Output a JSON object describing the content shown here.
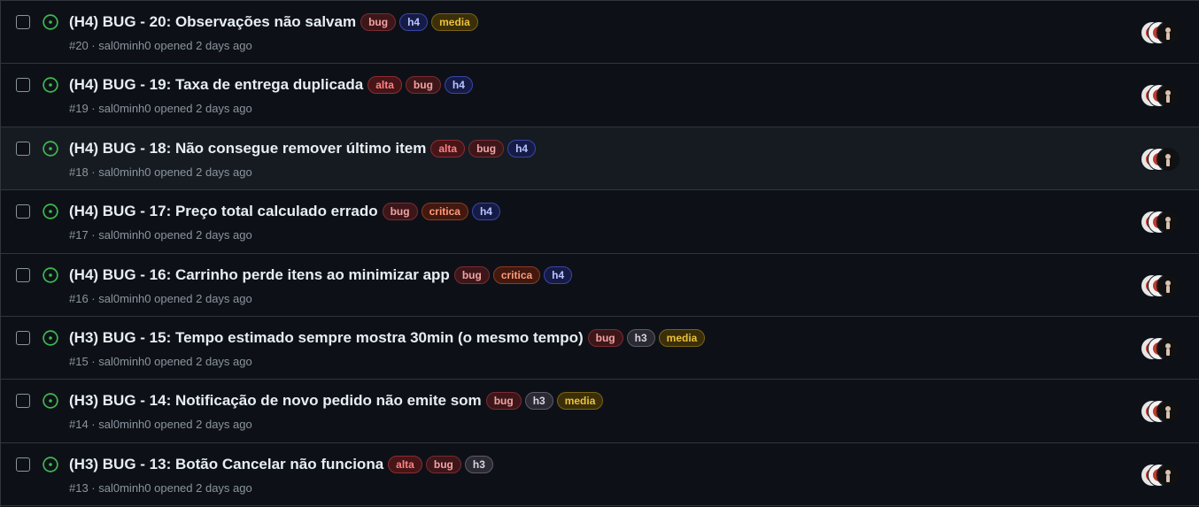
{
  "issues": [
    {
      "title": "(H4) BUG - 20: Observações não salvam",
      "labels": [
        "bug",
        "h4",
        "media"
      ],
      "meta": "#20 · ",
      "author": "sal0minh0",
      "opened": " opened 2 days ago"
    },
    {
      "title": "(H4) BUG - 19: Taxa de entrega duplicada",
      "labels": [
        "alta",
        "bug",
        "h4"
      ],
      "meta": "#19 · ",
      "author": "sal0minh0",
      "opened": " opened 2 days ago"
    },
    {
      "title": "(H4) BUG - 18: Não consegue remover último item",
      "labels": [
        "alta",
        "bug",
        "h4"
      ],
      "meta": "#18 · ",
      "author": "sal0minh0",
      "opened": " opened 2 days ago"
    },
    {
      "title": "(H4) BUG - 17: Preço total calculado errado",
      "labels": [
        "bug",
        "critica",
        "h4"
      ],
      "meta": "#17 · ",
      "author": "sal0minh0",
      "opened": " opened 2 days ago"
    },
    {
      "title": "(H4) BUG - 16: Carrinho perde itens ao minimizar app",
      "labels": [
        "bug",
        "critica",
        "h4"
      ],
      "meta": "#16 · ",
      "author": "sal0minh0",
      "opened": " opened 2 days ago"
    },
    {
      "title": "(H3) BUG - 15: Tempo estimado sempre mostra 30min (o mesmo tempo)",
      "labels": [
        "bug",
        "h3",
        "media"
      ],
      "meta": "#15 · ",
      "author": "sal0minh0",
      "opened": " opened 2 days ago"
    },
    {
      "title": "(H3) BUG - 14: Notificação de novo pedido não emite som",
      "labels": [
        "bug",
        "h3",
        "media"
      ],
      "meta": "#14 · ",
      "author": "sal0minh0",
      "opened": " opened 2 days ago"
    },
    {
      "title": "(H3) BUG - 13: Botão Cancelar não funciona",
      "labels": [
        "alta",
        "bug",
        "h3"
      ],
      "meta": "#13 · ",
      "author": "sal0minh0",
      "opened": " opened 2 days ago"
    }
  ],
  "icons": {
    "status": "issue-opened-icon",
    "checkbox": "checkbox",
    "avatar": "avatar"
  },
  "colors": {
    "background": "#0d1117",
    "hover_background": "#161b22",
    "border": "#30363d",
    "open_icon": "#3fb950",
    "title": "#e6edf3",
    "muted": "#8b949e"
  },
  "hovered_row": 2
}
